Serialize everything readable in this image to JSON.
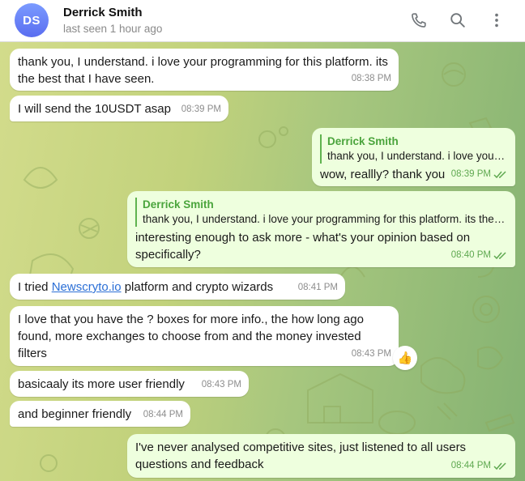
{
  "header": {
    "avatar_initials": "DS",
    "contact_name": "Derrick Smith",
    "last_seen": "last seen 1 hour ago"
  },
  "colors": {
    "avatar": "#6a84f8",
    "incoming_bubble": "#ffffff",
    "outgoing_bubble": "#eeffde",
    "accent_green": "#4aa43c",
    "link": "#2b6fd6"
  },
  "messages": [
    {
      "direction": "in",
      "text": "thank you, I understand. i love your programming for this platform. its the best that I have seen.",
      "time": "08:38 PM"
    },
    {
      "direction": "in",
      "text": "I will send the 10USDT asap",
      "time": "08:39 PM"
    },
    {
      "direction": "out",
      "reply_name": "Derrick Smith",
      "reply_text": "thank you, I understand. i love your programming for this platform. its the best that I have seen.",
      "text": "wow, reallly? thank you",
      "time": "08:39 PM",
      "status": "read"
    },
    {
      "direction": "out",
      "reply_name": "Derrick Smith",
      "reply_text": "thank you, I understand. i love your programming for this platform. its the best that I have seen.",
      "text": "interesting enough to ask more - what's your opinion based on specifically?",
      "time": "08:40 PM",
      "status": "read"
    },
    {
      "direction": "in",
      "text_before": "I tried ",
      "link_text": "Newscryto.io",
      "text_after": " platform and crypto wizards",
      "time": "08:41 PM"
    },
    {
      "direction": "in",
      "text": "I love that you have the ? boxes for more info., the how long ago found, more exchanges to choose from and the money invested filters",
      "time": "08:43 PM",
      "reaction": "👍"
    },
    {
      "direction": "in",
      "text": "basicaaly its more user friendly",
      "time": "08:43 PM"
    },
    {
      "direction": "in",
      "text": "and beginner friendly",
      "time": "08:44 PM"
    },
    {
      "direction": "out",
      "text": "I've never analysed competitive sites, just listened to all users questions and feedback",
      "time": "08:44 PM",
      "status": "read"
    }
  ]
}
